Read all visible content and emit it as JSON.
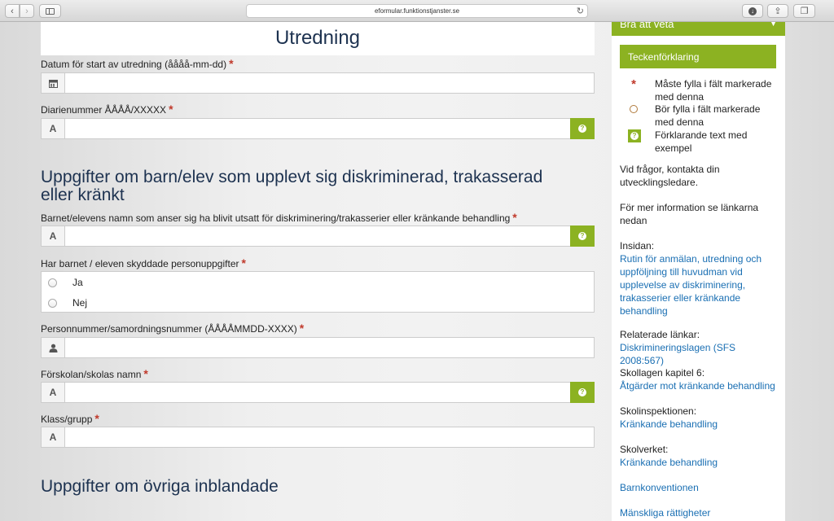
{
  "browser": {
    "url": "eformular.funktionstjanster.se"
  },
  "form": {
    "title": "Utredning",
    "fields": {
      "start_date": {
        "label": "Datum för start av utredning (åååå-mm-dd)"
      },
      "diary_number": {
        "label": "Diarienummer ÅÅÅÅ/XXXXX"
      },
      "child_name": {
        "label": "Barnet/elevens namn som anser sig ha blivit utsatt för diskriminering/trakasserier eller kränkande behandling"
      },
      "protected_data": {
        "label": "Har barnet / eleven skyddade personuppgifter",
        "options": [
          "Ja",
          "Nej"
        ]
      },
      "personal_number": {
        "label": "Personnummer/samordningsnummer (ÅÅÅÅMMDD-XXXX)"
      },
      "school_name": {
        "label": "Förskolan/skolas namn"
      },
      "class_group": {
        "label": "Klass/grupp"
      }
    },
    "section1_title": "Uppgifter om barn/elev som upplevt sig diskriminerad, trakasserad eller kränkt",
    "section2_title": "Uppgifter om övriga inblandade",
    "required_mark": "*"
  },
  "sidebar": {
    "header": "Bra att veta",
    "legend_title": "Teckenförklaring",
    "legend": [
      {
        "text": "Måste fylla i fält markerade med denna"
      },
      {
        "text": "Bör fylla i fält markerade med denna"
      },
      {
        "text": "Förklarande text med exempel"
      }
    ],
    "contact_text": "Vid frågor, kontakta din utvecklingsledare.",
    "info_text": "För mer information se länkarna nedan",
    "insidan_label": "Insidan:",
    "insidan_link": "Rutin för anmälan, utredning och uppföljning till huvudman vid upplevelse av diskriminering, trakasserier eller kränkande behandling",
    "related_label": "Relaterade länkar:",
    "related_link": "Diskrimineringslagen (SFS 2008:567)",
    "skollagen_label": "Skollagen kapitel 6:",
    "skollagen_link": "Åtgärder mot kränkande behandling",
    "skolinspektionen_label": "Skolinspektionen:",
    "skolinspektionen_link": "Kränkande behandling",
    "skolverket_label": "Skolverket:",
    "skolverket_link": "Kränkande behandling",
    "barnkonventionen_link": "Barnkonventionen",
    "rights_link": "Mänskliga rättigheter"
  }
}
